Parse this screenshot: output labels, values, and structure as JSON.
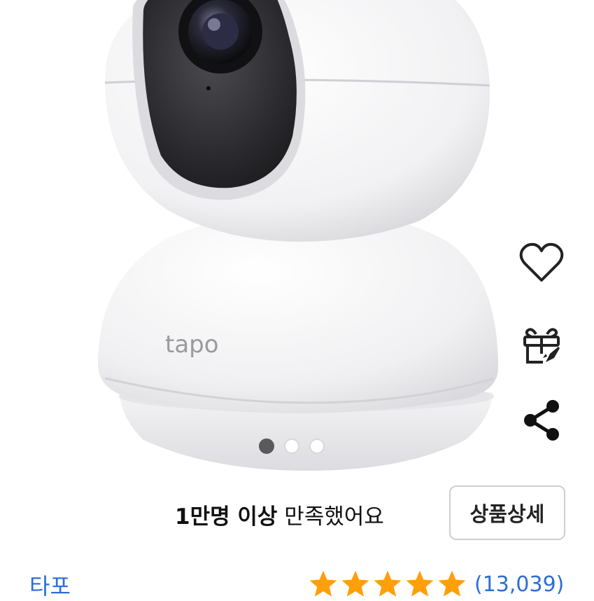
{
  "product": {
    "brand_logo_text": "tapo",
    "brand": "타포",
    "satisfaction_bold": "1만명 이상",
    "satisfaction_rest": " 만족했어요",
    "detail_button_label": "상품상세",
    "rating_stars": 5,
    "rating_max": 5,
    "review_count": "(13,039)"
  },
  "gallery": {
    "image_count": 3,
    "active_index": 0
  },
  "side_actions": {
    "icons": [
      "heart-icon",
      "gift-icon",
      "share-icon"
    ]
  },
  "colors": {
    "link_blue": "#2b6fd6",
    "star_orange": "#ff9f0a",
    "active_dot": "#5a5a5a"
  }
}
